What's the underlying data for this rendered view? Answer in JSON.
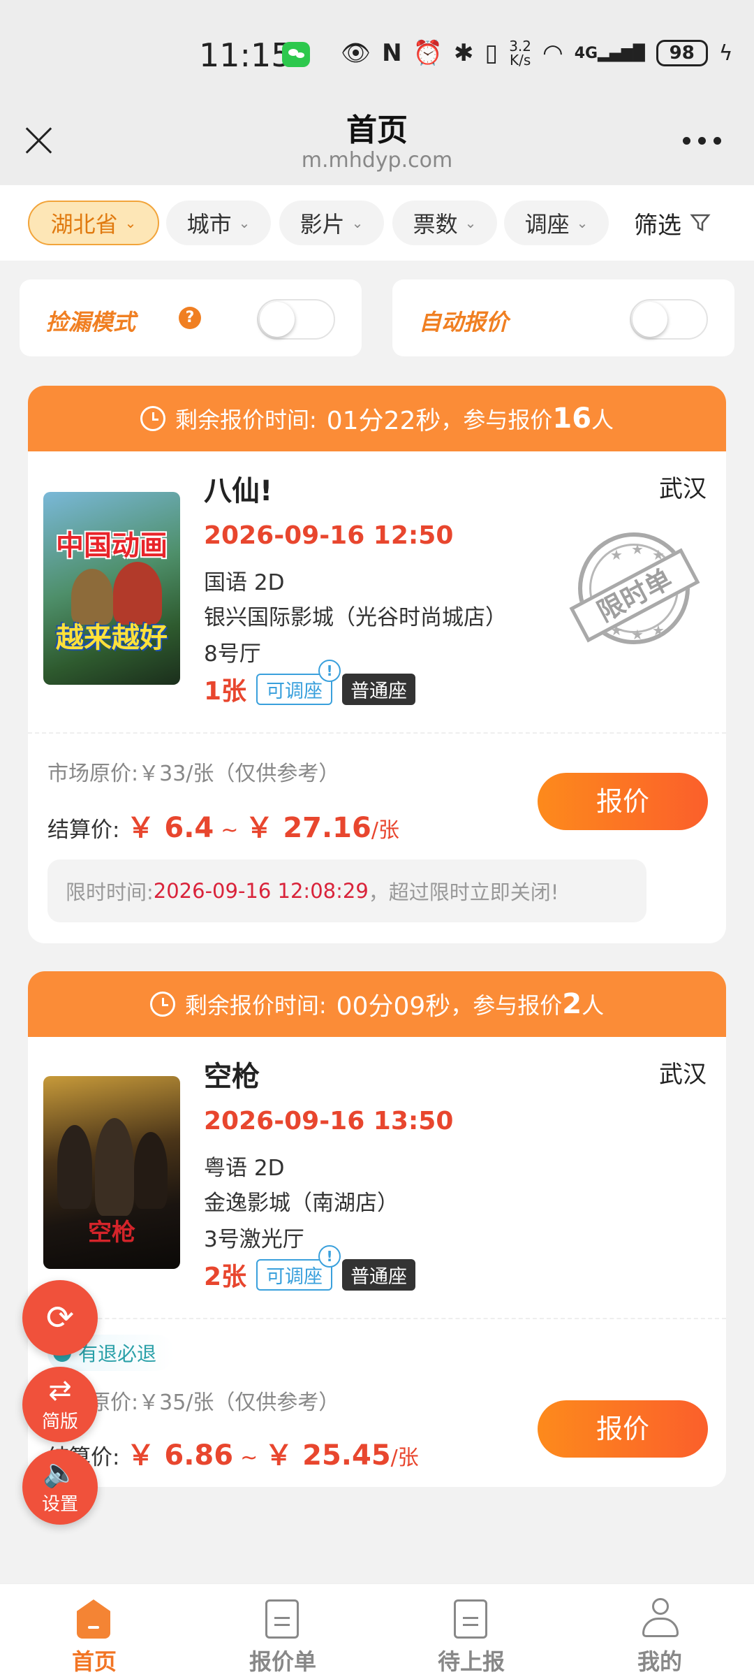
{
  "status_bar": {
    "time": "11:15",
    "network_speed_value": "3.2",
    "network_speed_unit": "K/s",
    "network_type": "4G",
    "battery": "98"
  },
  "browser": {
    "title": "首页",
    "url": "m.mhdyp.com"
  },
  "filters": {
    "province": "湖北省",
    "city": "城市",
    "movie": "影片",
    "tickets": "票数",
    "seat_adjust": "调座",
    "filter": "筛选"
  },
  "toggles": {
    "pickup_mode_label": "捡漏模式",
    "pickup_mode_help": "?",
    "auto_quote_label": "自动报价"
  },
  "orders": [
    {
      "header_label": "剩余报价时间:",
      "remaining_time": "01分22秒",
      "participants_prefix": "，参与报价",
      "participants_count": "16",
      "participants_suffix": "人",
      "poster_text_top": "中国动画",
      "poster_text_bottom": "越来越好",
      "title": "八仙!",
      "city": "武汉",
      "datetime": "2026-09-16 12:50",
      "language_format": "国语 2D",
      "cinema": "银兴国际影城（光谷时尚城店）",
      "hall": "8号厅",
      "ticket_count": "1张",
      "adjust_tag": "可调座",
      "seat_tag": "普通座",
      "stamp_text": "限时单",
      "market_price": "市场原价:￥33/张（仅供参考）",
      "settle_label": "结算价:",
      "settle_low": "￥ 6.4",
      "settle_sep": "~",
      "settle_high": "￥ 27.16",
      "settle_unit": "/张",
      "quote_button": "报价",
      "deadline_label": "限时时间:",
      "deadline_time": "2026-09-16 12:08:29",
      "deadline_suffix": "，超过限时立即关闭!"
    },
    {
      "header_label": "剩余报价时间:",
      "remaining_time": "00分09秒",
      "participants_prefix": "，参与报价",
      "participants_count": "2",
      "participants_suffix": "人",
      "poster_text_top": "空枪",
      "title": "空枪",
      "city": "武汉",
      "datetime": "2026-09-16 13:50",
      "language_format": "粤语 2D",
      "cinema": "金逸影城（南湖店）",
      "hall": "3号激光厅",
      "ticket_count": "2张",
      "adjust_tag": "可调座",
      "seat_tag": "普通座",
      "refund_badge": "有退必退",
      "market_price": "市场原价:￥35/张（仅供参考）",
      "settle_label": "结算价:",
      "settle_low": "￥ 6.86",
      "settle_sep": "~",
      "settle_high": "￥ 25.45",
      "settle_unit": "/张",
      "quote_button": "报价"
    }
  ],
  "fabs": {
    "refresh_icon": "refresh-icon",
    "switch_label": "简版",
    "settings_label": "设置"
  },
  "nav": {
    "home": "首页",
    "quote_list": "报价单",
    "pending": "待上报",
    "mine": "我的"
  },
  "colors": {
    "accent_orange": "#fb8c37",
    "price_red": "#e8462e",
    "fab_red": "#f0513b",
    "tag_blue": "#3aa0dc"
  }
}
